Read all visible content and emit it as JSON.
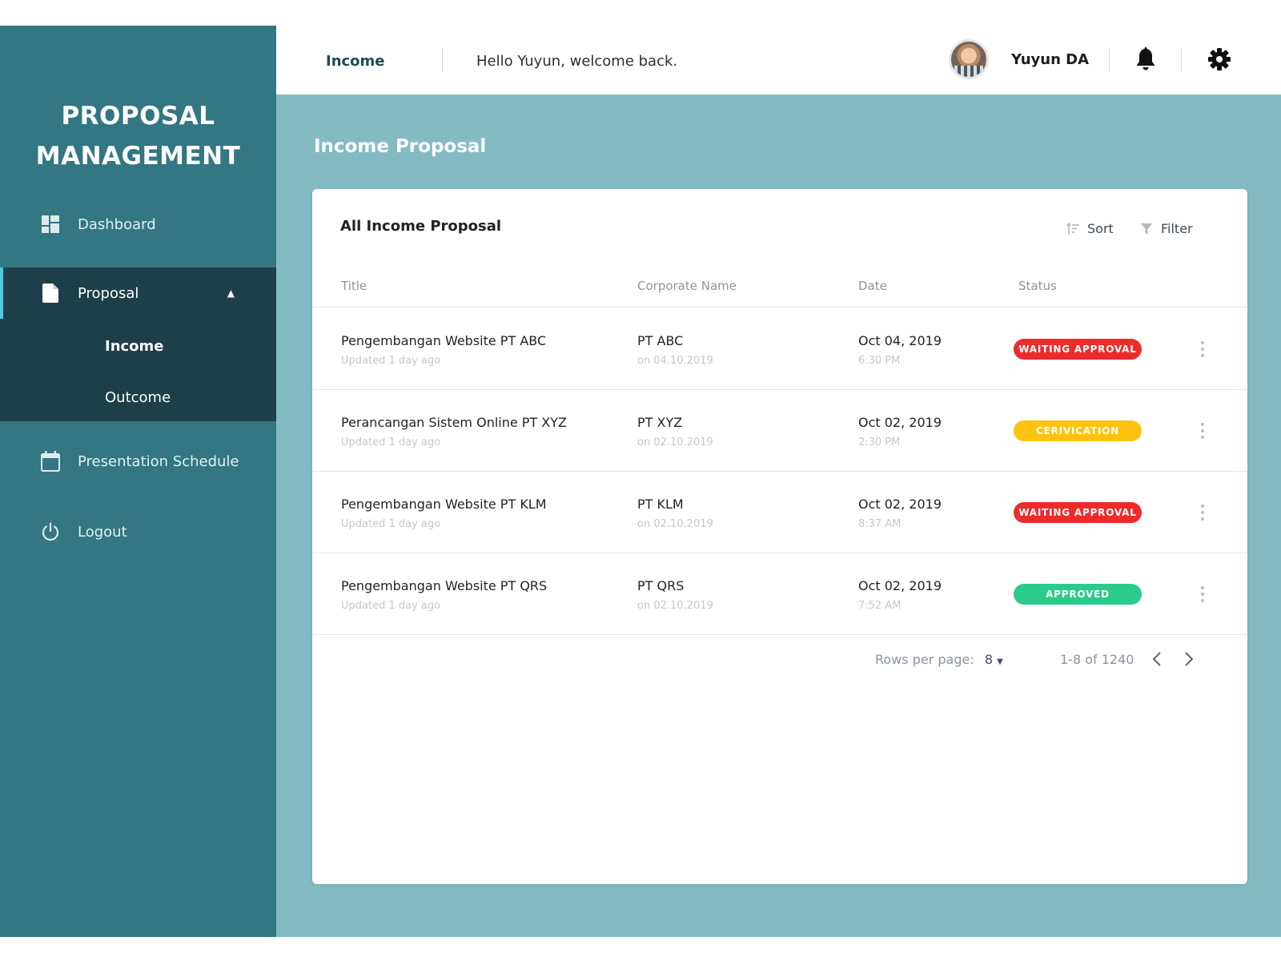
{
  "sidebar": {
    "brand_line1": "PROPOSAL",
    "brand_line2": "MANAGEMENT",
    "dashboard": {
      "label": "Dashboard",
      "icon": "dashboard-icon"
    },
    "proposal": {
      "label": "Proposal",
      "icon": "file-icon",
      "expanded": true
    },
    "proposal_sub": {
      "income": "Income",
      "outcome": "Outcome"
    },
    "schedule": {
      "label": "Presentation Schedule",
      "icon": "calendar-icon"
    },
    "logout": {
      "label": "Logout",
      "icon": "power-icon"
    }
  },
  "header": {
    "section": "Income",
    "welcome": "Hello Yuyun, welcome back.",
    "user_name": "Yuyun DA"
  },
  "page": {
    "title": "Income Proposal",
    "card_title": "All Income Proposal",
    "sort_label": "Sort",
    "filter_label": "Filter"
  },
  "table": {
    "columns": {
      "title": "Title",
      "corporate": "Corporate Name",
      "date": "Date",
      "status": "Status"
    },
    "rows": [
      {
        "title": "Pengembangan Website PT ABC",
        "updated": "Updated 1 day ago",
        "corporate": "PT ABC",
        "corp_date": "on 04.10.2019",
        "date": "Oct 04, 2019",
        "time": "6:30 PM",
        "status": "WAITING APPROVAL",
        "status_color": "#ee2b2b"
      },
      {
        "title": "Perancangan Sistem Online PT XYZ",
        "updated": "Updated 1 day ago",
        "corporate": "PT XYZ",
        "corp_date": "on 02.10.2019",
        "date": "Oct 02, 2019",
        "time": "2:30 PM",
        "status": "CERIVICATION",
        "status_color": "#fdc30f"
      },
      {
        "title": "Pengembangan Website PT KLM",
        "updated": "Updated 1 day ago",
        "corporate": "PT KLM",
        "corp_date": "on 02.10.2019",
        "date": "Oct 02, 2019",
        "time": "8:37 AM",
        "status": "WAITING APPROVAL",
        "status_color": "#ee2b2b"
      },
      {
        "title": "Pengembangan Website PT QRS",
        "updated": "Updated 1 day ago",
        "corporate": "PT QRS",
        "corp_date": "on 02.10.2019",
        "date": "Oct 02, 2019",
        "time": "7:52 AM",
        "status": "APPROVED",
        "status_color": "#2bcb8c"
      }
    ]
  },
  "pagination": {
    "rows_per_page_label": "Rows per page:",
    "rows_per_page_value": "8",
    "range": "1-8 of 1240"
  },
  "colors": {
    "sidebar_bg": "#327782",
    "sidebar_active_bg": "#1d3f49",
    "main_bg": "#84bbc3",
    "accent": "#4fc9de"
  }
}
